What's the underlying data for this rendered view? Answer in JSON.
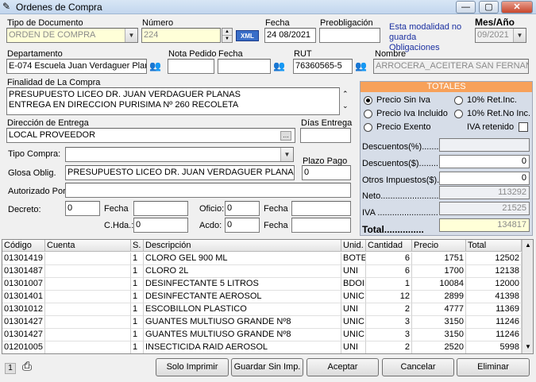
{
  "window": {
    "title": "Ordenes de Compra",
    "min": "—",
    "max": "▢",
    "close": "✕"
  },
  "form": {
    "tipo_documento_label": "Tipo de Documento",
    "tipo_documento_value": "ORDEN DE COMPRA",
    "numero_label": "Número",
    "numero_value": "224",
    "xml_label": "XML",
    "fecha_label": "Fecha",
    "fecha_value": "24 08/2021",
    "preobligacion_label": "Preobligación",
    "preobligacion_value": "",
    "modalidad_note": "Esta modalidad no guarda Obligaciones",
    "mes_anio_label": "Mes/Año",
    "mes_anio_value": "09/2021",
    "departamento_label": "Departamento",
    "departamento_value": "E-074 Escuela Juan Verdaguer Plan",
    "nota_pedido_label": "Nota Pedido",
    "nota_pedido_value": "",
    "fecha2_label": "Fecha",
    "fecha2_value": "",
    "rut_label": "RUT",
    "rut_value": "76360565-5",
    "nombre_label": "Nombre",
    "nombre_value": "ARROCERA_ACEITERA SAN FERNANDO",
    "finalidad_label": "Finalidad de La Compra",
    "finalidad_line1": "PRESUPUESTO LICEO DR. JUAN VERDAGUER PLANAS",
    "finalidad_line2": "ENTREGA EN DIRECCION PURISIMA Nº 260 RECOLETA",
    "direccion_label": "Dirección de Entrega",
    "direccion_value": "LOCAL PROVEEDOR",
    "dias_entrega_label": "Días Entrega",
    "dias_entrega_value": "",
    "tipo_compra_label": "Tipo Compra:",
    "tipo_compra_value": "",
    "plazo_pago_label": "Plazo Pago",
    "plazo_pago_value": "0",
    "glosa_label": "Glosa Oblig.",
    "glosa_value": "PRESUPUESTO LICEO DR. JUAN VERDAGUER PLANAS",
    "autorizado_label": "Autorizado Por:",
    "autorizado_value": "",
    "decreto_label": "Decreto:",
    "decreto_value": "0",
    "fecha3_label": "Fecha",
    "fecha3_value": "",
    "oficio_label": "Oficio:",
    "oficio_value": "0",
    "fecha4_label": "Fecha",
    "fecha4_value": "",
    "chda_label": "C.Hda.:",
    "chda_value": "0",
    "acdo_label": "Acdo:",
    "acdo_value": "0",
    "fecha5_label": "Fecha",
    "fecha5_value": ""
  },
  "totales": {
    "header": "TOTALES",
    "opt_sin_iva": "Precio Sin Iva",
    "opt_iva_incluido": "Precio Iva Incluido",
    "opt_exento": "Precio Exento",
    "opt_ret_inc": "10% Ret.Inc.",
    "opt_ret_no_inc": "10% Ret.No Inc.",
    "iva_retenido": "IVA retenido",
    "descuentos_pct_label": "Descuentos(%).........",
    "descuentos_pct_value": "",
    "descuentos_label": "Descuentos($)..........",
    "descuentos_value": "0",
    "otros_label": "Otros Impuestos($)..",
    "otros_value": "0",
    "neto_label": "Neto.........................",
    "neto_value": "113292",
    "iva_label": "IVA .........................",
    "iva_value": "21525",
    "total_label": "Total...............",
    "total_value": "134817"
  },
  "table": {
    "headers": [
      "Código",
      "Cuenta",
      "S.",
      "Descripción",
      "Unid.",
      "Cantidad",
      "Precio",
      "Total"
    ],
    "rows": [
      [
        "01301419",
        "",
        "1",
        "CLORO GEL 900 ML",
        "BOTE",
        "6",
        "1751",
        "12502"
      ],
      [
        "01301487",
        "",
        "1",
        "CLORO 2L",
        "UNI",
        "6",
        "1700",
        "12138"
      ],
      [
        "01301007",
        "",
        "1",
        "DESINFECTANTE 5 LITROS",
        "BDOI",
        "1",
        "10084",
        "12000"
      ],
      [
        "01301401",
        "",
        "1",
        "DESINFECTANTE AEROSOL",
        "UNIC",
        "12",
        "2899",
        "41398"
      ],
      [
        "01301012",
        "",
        "1",
        "ESCOBILLON PLASTICO",
        "UNI",
        "2",
        "4777",
        "11369"
      ],
      [
        "01301427",
        "",
        "1",
        "GUANTES MULTIUSO GRANDE Nº8",
        "UNIC",
        "3",
        "3150",
        "11246"
      ],
      [
        "01301427",
        "",
        "1",
        "GUANTES MULTIUSO GRANDE Nº8",
        "UNIC",
        "3",
        "3150",
        "11246"
      ],
      [
        "01201005",
        "",
        "1",
        "INSECTICIDA RAID AEROSOL",
        "UNI",
        "2",
        "2520",
        "5998"
      ]
    ]
  },
  "footer": {
    "page": "1",
    "solo_imprimir": "Solo Imprimir",
    "guardar": "Guardar Sin Imp.",
    "aceptar": "Aceptar",
    "cancelar": "Cancelar",
    "eliminar": "Eliminar"
  }
}
